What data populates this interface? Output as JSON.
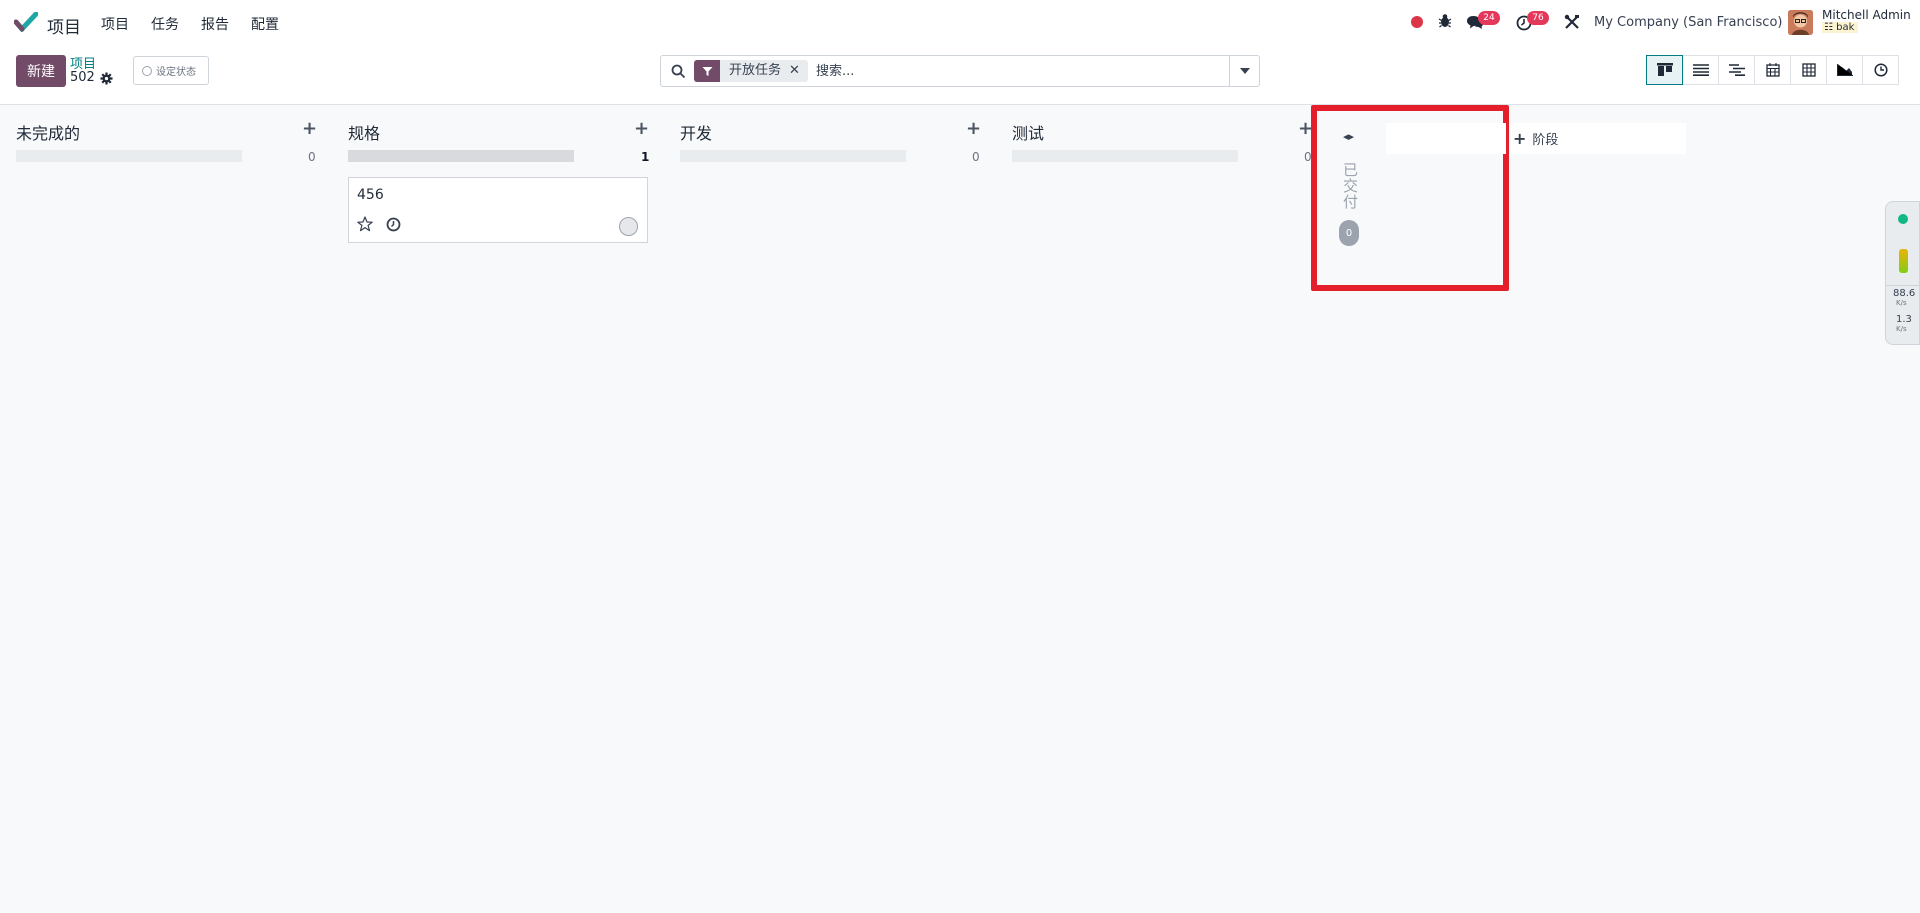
{
  "navbar": {
    "app_name": "项目",
    "menu": [
      "项目",
      "任务",
      "报告",
      "配置"
    ],
    "messages_badge": "24",
    "activities_badge": "76",
    "company": "My Company (San Francisco)",
    "user_name": "Mitchell Admin",
    "user_db": "bak"
  },
  "control": {
    "new_label": "新建",
    "breadcrumb_link": "项目",
    "breadcrumb_value": "502",
    "status_label": "设定状态",
    "search": {
      "facet": "开放任务",
      "placeholder": "搜索..."
    },
    "views": [
      "kanban",
      "list",
      "gantt",
      "calendar",
      "pivot",
      "graph",
      "activity"
    ],
    "active_view": "kanban"
  },
  "kanban": {
    "columns": [
      {
        "title": "未完成的",
        "count": "0"
      },
      {
        "title": "规格",
        "count": "1"
      },
      {
        "title": "开发",
        "count": "0"
      },
      {
        "title": "测试",
        "count": "0"
      }
    ],
    "card": {
      "title": "456"
    },
    "folded_column": {
      "title": "已交付",
      "count": "0"
    },
    "add_stage_label": "阶段"
  },
  "monitor": {
    "upload": "88.6",
    "upload_unit": "K/s",
    "download": "1.3",
    "download_unit": "K/s"
  },
  "colors": {
    "primary": "#714b67",
    "link": "#017e84",
    "highlight": "#e41e2b",
    "badge": "#e4385b"
  }
}
